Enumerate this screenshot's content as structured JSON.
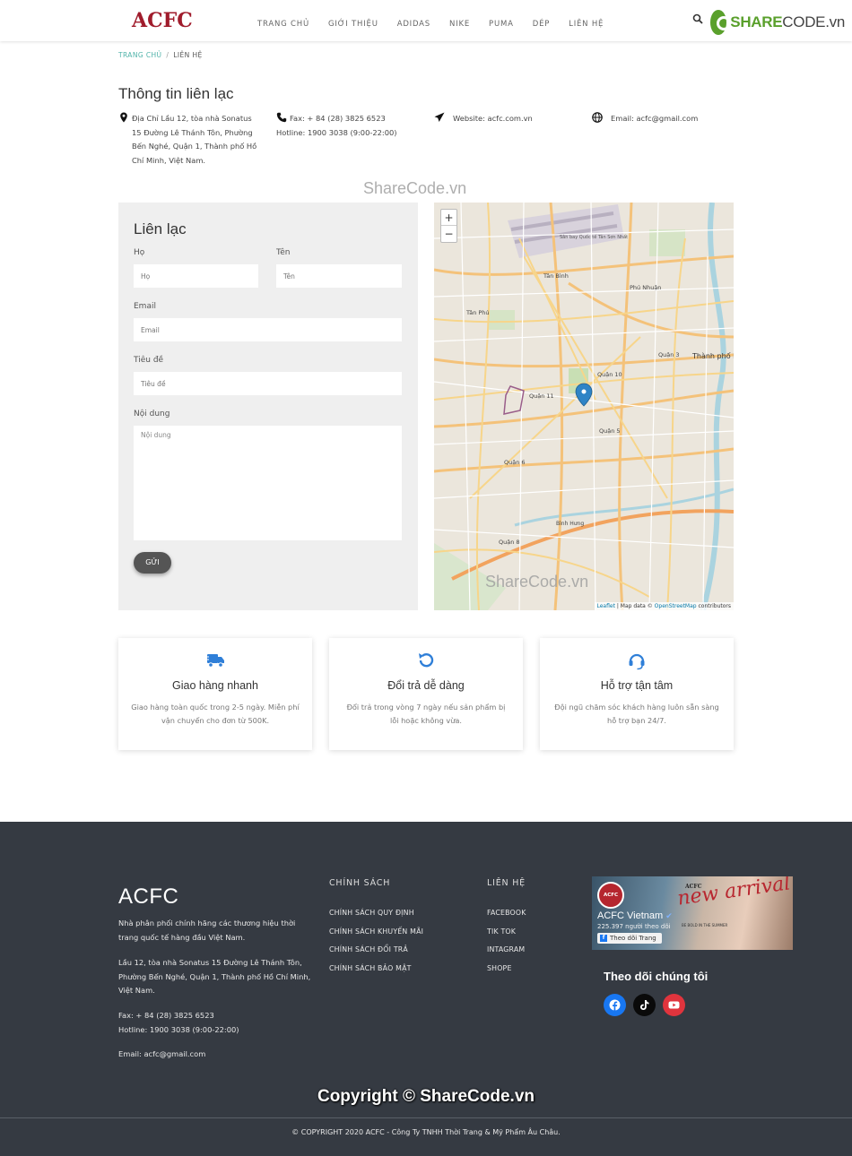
{
  "header": {
    "logo": "ACFC",
    "nav": [
      "TRANG CHỦ",
      "GIỚI THIỆU",
      "ADIDAS",
      "NIKE",
      "PUMA",
      "DÉP",
      "LIÊN HỆ"
    ],
    "sharecode_logo_main": "SHARE",
    "sharecode_logo_rest": "CODE.vn"
  },
  "breadcrumb": {
    "home": "TRANG CHỦ",
    "separator": "/",
    "current": "LIÊN HỆ"
  },
  "contact_info": {
    "title": "Thông tin liên lạc",
    "address": "Địa Chỉ Lầu 12, tòa nhà Sonatus 15 Đường Lê Thánh Tôn, Phường Bến Nghé, Quận 1, Thành phố Hồ Chí Minh, Việt Nam.",
    "fax": "Fax: + 84 (28) 3825 6523",
    "hotline": "Hotline: 1900 3038 (9:00-22:00)",
    "website": "Website: acfc.com.vn",
    "email": "Email: acfc@gmail.com"
  },
  "watermark": "ShareCode.vn",
  "form": {
    "title": "Liên lạc",
    "first_name_label": "Họ",
    "first_name_placeholder": "Họ",
    "last_name_label": "Tên",
    "last_name_placeholder": "Tên",
    "email_label": "Email",
    "email_placeholder": "Email",
    "subject_label": "Tiêu đề",
    "subject_placeholder": "Tiêu đề",
    "content_label": "Nội dung",
    "content_placeholder": "Nội dung",
    "submit_label": "GỬI"
  },
  "map": {
    "zoom_in": "+",
    "zoom_out": "−",
    "labels": [
      "Quận 10",
      "Quận 11",
      "Quận 3",
      "Quận 5",
      "Quận 6",
      "Quận 8",
      "Tân Bình",
      "Tân Phú",
      "Phú Nhuận",
      "Bình Hưng",
      "Thành phố Hồ Chí Minh",
      "Sân bay Quốc tế Tân Sơn Nhất"
    ],
    "attribution_leaflet": "Leaflet",
    "attribution_mid": " | Map data © ",
    "attribution_osm": "OpenStreetMap",
    "attribution_end": " contributors"
  },
  "features": [
    {
      "icon": "truck-icon",
      "title": "Giao hàng nhanh",
      "desc": "Giao hàng toàn quốc trong 2-5 ngày. Miễn phí vận chuyển cho đơn từ 500K."
    },
    {
      "icon": "return-icon",
      "title": "Đổi trả dễ dàng",
      "desc": "Đổi trả trong vòng 7 ngày nếu sản phẩm bị lỗi hoặc không vừa."
    },
    {
      "icon": "headset-icon",
      "title": "Hỗ trợ tận tâm",
      "desc": "Đội ngũ chăm sóc khách hàng luôn sẵn sàng hỗ trợ bạn 24/7."
    }
  ],
  "footer": {
    "brand": "ACFC",
    "about": "Nhà phân phối chính hãng các thương hiệu thời trang quốc tế hàng đầu Việt Nam.",
    "address": "Lầu 12, tòa nhà Sonatus 15 Đường Lê Thánh Tôn, Phường Bến Nghé, Quận 1, Thành phố Hồ Chí Minh, Việt Nam.",
    "fax": "Fax: + 84 (28) 3825 6523",
    "hotline": "Hotline: 1900 3038 (9:00-22:00)",
    "email": "Email: acfc@gmail.com",
    "policy_heading": "CHÍNH SÁCH",
    "policy_links": [
      "CHÍNH SÁCH QUY ĐỊNH",
      "CHÍNH SÁCH KHUYẾN MÃI",
      "CHÍNH SÁCH ĐỔI TRẢ",
      "CHÍNH SÁCH BẢO MẬT"
    ],
    "contact_heading": "LIÊN HỆ",
    "contact_links": [
      "FACEBOOK",
      "TIK TOK",
      "INTAGRAM",
      "SHOPE"
    ],
    "fb_card": {
      "avatar_text": "ACFC",
      "page_name": "ACFC Vietnam",
      "followers": "225.397 người theo dõi",
      "follow_button": "Theo dõi Trang",
      "banner_brand": "ACFC",
      "banner_text": "new arrival",
      "banner_tag": "BE BOLD IN THE SUMMER"
    },
    "follow_title": "Theo dõi chúng tôi",
    "copyright_watermark": "Copyright © ShareCode.vn",
    "copyright": "© COPYRIGHT 2020 ACFC - Công Ty TNHH Thời Trang & Mỹ Phẩm Âu Châu."
  },
  "colors": {
    "brand_red": "#a01c2c",
    "breadcrumb_link": "#4fb3a9",
    "footer_bg": "#353a42",
    "icon_blue": "#2f7fd8",
    "facebook": "#1877f2",
    "youtube": "#e0343d"
  }
}
